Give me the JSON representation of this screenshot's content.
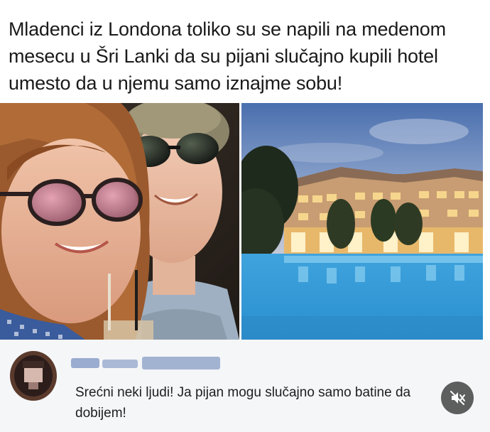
{
  "post": {
    "headline": "Mladenci iz Londona toliko su se napili na medenom mesecu u Šri Lanki  da su pijani slučajno kupili hotel umesto da u njemu samo iznajme sobu!"
  },
  "photos": {
    "left_icon": "couple-selfie-photo",
    "right_icon": "hotel-pool-photo"
  },
  "comment": {
    "author": "",
    "text": "Srećni neki ljudi! Ja pijan mogu slučajno samo batine da dobijem!"
  },
  "controls": {
    "mute_icon": "speaker-muted-icon"
  }
}
